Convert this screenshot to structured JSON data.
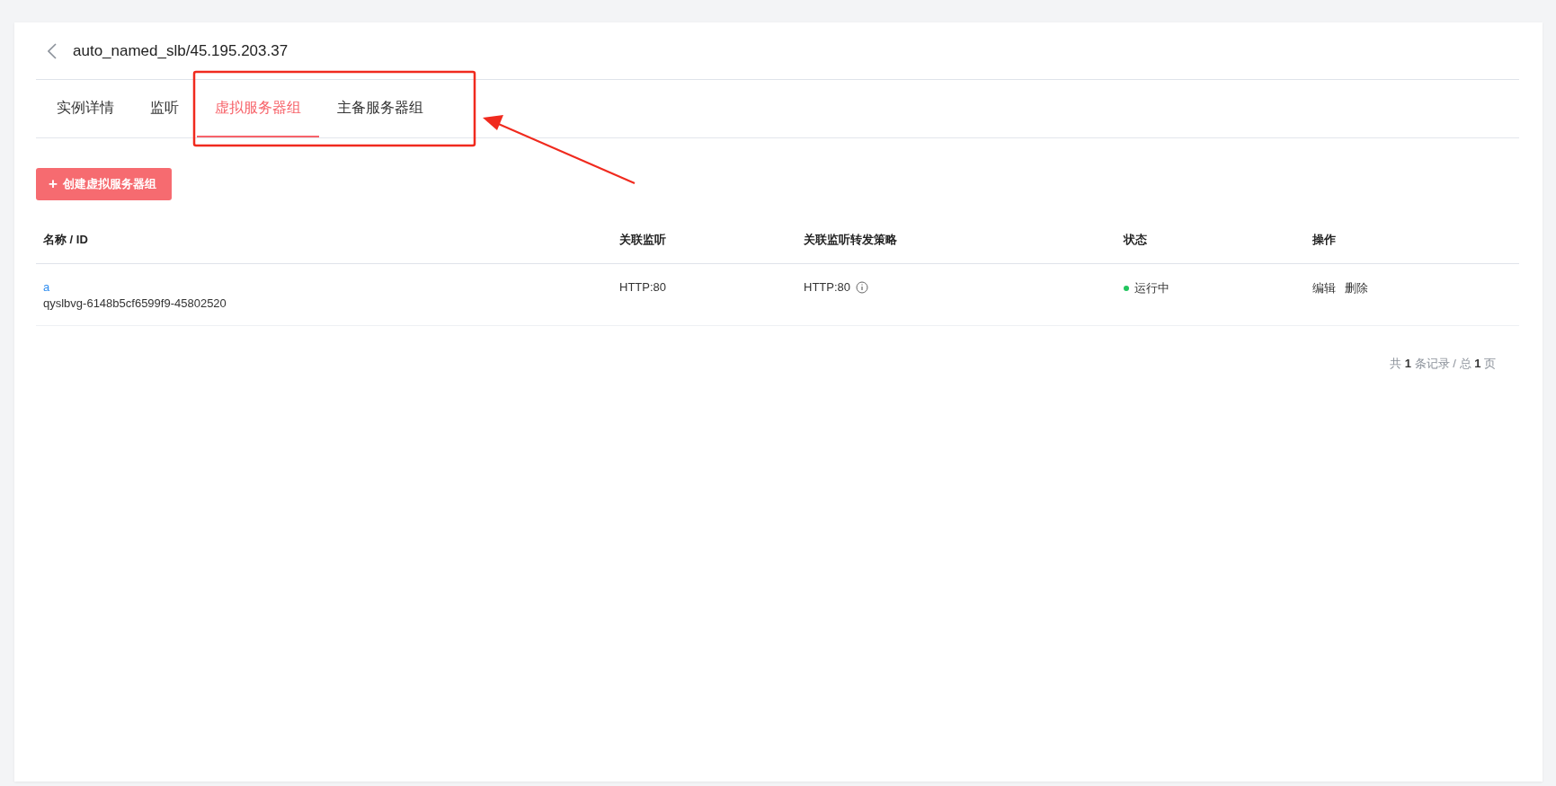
{
  "header": {
    "title": "auto_named_slb/45.195.203.37"
  },
  "tabs": [
    {
      "label": "实例详情",
      "selected": false
    },
    {
      "label": "监听",
      "selected": false
    },
    {
      "label": "虚拟服务器组",
      "selected": true
    },
    {
      "label": "主备服务器组",
      "selected": false
    }
  ],
  "create_button": {
    "icon": "+",
    "label": "创建虚拟服务器组"
  },
  "table": {
    "columns": [
      "名称 / ID",
      "关联监听",
      "关联监听转发策略",
      "状态",
      "操作"
    ],
    "rows": [
      {
        "name": "a",
        "id": "qyslbvg-6148b5cf6599f9-45802520",
        "listener": "HTTP:80",
        "policy": "HTTP:80",
        "status": "运行中",
        "color": "#22c55e",
        "actions": [
          "编辑",
          "删除"
        ]
      }
    ]
  },
  "pagination": "共 **1** 条记录 / 总 **1** 页"
}
